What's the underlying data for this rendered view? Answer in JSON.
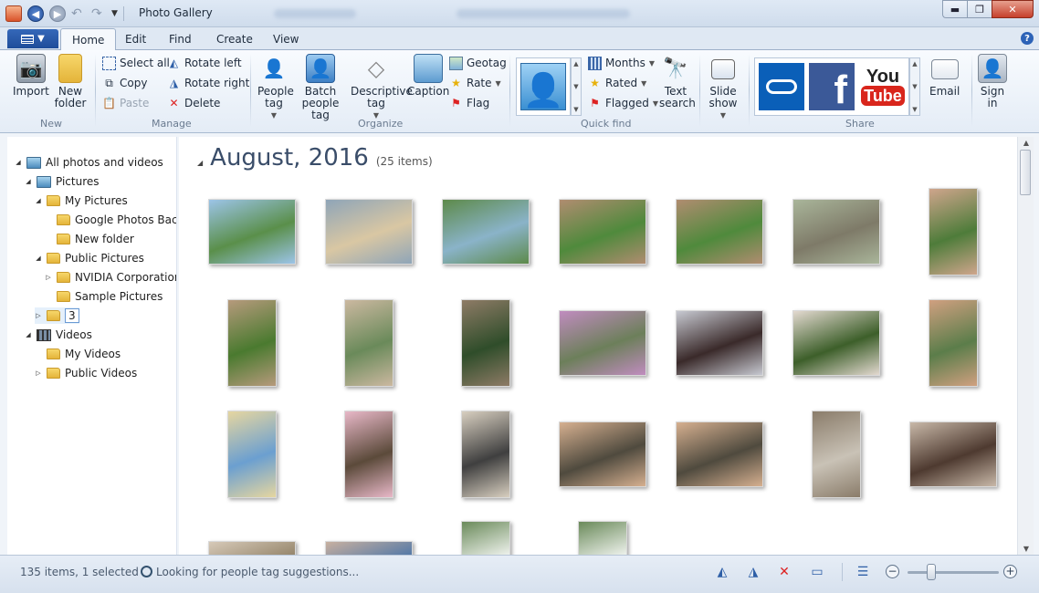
{
  "window": {
    "title": "Photo Gallery",
    "controls": {
      "minimize": "▬",
      "maximize": "❐",
      "close": "✕"
    }
  },
  "tabs": {
    "file": "",
    "items": [
      "Home",
      "Edit",
      "Find",
      "Create",
      "View"
    ],
    "active": "Home",
    "help": "?"
  },
  "ribbon": {
    "new": {
      "label": "New",
      "import": "Import",
      "new_folder": "New folder"
    },
    "manage": {
      "label": "Manage",
      "select_all": "Select all",
      "copy": "Copy",
      "paste": "Paste",
      "rotate_left": "Rotate left",
      "rotate_right": "Rotate right",
      "delete": "Delete"
    },
    "organize": {
      "label": "Organize",
      "people_tag": "People tag",
      "batch_people_tag": "Batch people tag",
      "descriptive_tag": "Descriptive tag",
      "caption": "Caption",
      "geotag": "Geotag",
      "rate": "Rate",
      "flag": "Flag"
    },
    "quick_find": {
      "label": "Quick find",
      "months": "Months",
      "rated": "Rated",
      "flagged": "Flagged",
      "text_search": "Text search"
    },
    "slide_show": "Slide show",
    "share": {
      "label": "Share",
      "youtube_word": "You",
      "youtube_tube": "Tube",
      "facebook": "f",
      "email": "Email",
      "sign_in": "Sign in"
    }
  },
  "nav_tree": [
    {
      "label": "All photos and videos",
      "indent": 0,
      "icon": "library-icon",
      "tri": "◢"
    },
    {
      "label": "Pictures",
      "indent": 1,
      "icon": "library-icon",
      "tri": "◢"
    },
    {
      "label": "My Pictures",
      "indent": 2,
      "icon": "folder-icon",
      "tri": "◢"
    },
    {
      "label": "Google Photos Backu",
      "indent": 3,
      "icon": "folder-icon",
      "tri": ""
    },
    {
      "label": "New folder",
      "indent": 3,
      "icon": "folder-icon",
      "tri": ""
    },
    {
      "label": "Public Pictures",
      "indent": 2,
      "icon": "folder-icon",
      "tri": "◢"
    },
    {
      "label": "NVIDIA Corporation",
      "indent": 3,
      "icon": "folder-icon",
      "tri": "▷"
    },
    {
      "label": "Sample Pictures",
      "indent": 3,
      "icon": "folder-icon",
      "tri": ""
    },
    {
      "label": "3",
      "indent": 2,
      "icon": "folder-icon",
      "tri": "▷",
      "selected": true
    },
    {
      "label": "Videos",
      "indent": 1,
      "icon": "film-icon",
      "tri": "◢"
    },
    {
      "label": "My Videos",
      "indent": 2,
      "icon": "folder-icon",
      "tri": ""
    },
    {
      "label": "Public Videos",
      "indent": 2,
      "icon": "folder-icon",
      "tri": "▷"
    }
  ],
  "content": {
    "month_title": "August, 2016",
    "count": "(25 items)",
    "thumbs": [
      {
        "c1": "#5a8f4a",
        "c2": "#9cc4e8"
      },
      {
        "c1": "#d9c7a3",
        "c2": "#8fa5b8"
      },
      {
        "c1": "#8ab3c9",
        "c2": "#5d8a4a"
      },
      {
        "c1": "#4f8a3c",
        "c2": "#b08c70"
      },
      {
        "c1": "#4f8a3c",
        "c2": "#b08c70"
      },
      {
        "c1": "#7e7a68",
        "c2": "#a9b59a"
      },
      {
        "c1": "#4e7c3a",
        "c2": "#cfa58c"
      },
      {
        "c1": "#4a7a2f",
        "c2": "#b69a7c"
      },
      {
        "c1": "#6a8a5a",
        "c2": "#cbb8a0"
      },
      {
        "c1": "#2f4d2a",
        "c2": "#8e7b66"
      },
      {
        "c1": "#6c7f5a",
        "c2": "#c08cbf"
      },
      {
        "c1": "#3a2a2a",
        "c2": "#c7c9d1"
      },
      {
        "c1": "#3d5f2a",
        "c2": "#e3d9d0"
      },
      {
        "c1": "#5b7d4a",
        "c2": "#d0a080"
      },
      {
        "c1": "#6b9fd0",
        "c2": "#e6d6a0"
      },
      {
        "c1": "#5b4a3a",
        "c2": "#e8b8c8"
      },
      {
        "c1": "#3f3f3f",
        "c2": "#d8cfc0"
      },
      {
        "c1": "#4f4a3e",
        "c2": "#d6b090"
      },
      {
        "c1": "#4f4a3e",
        "c2": "#d6b090"
      },
      {
        "c1": "#c9c2b6",
        "c2": "#8a7c6a"
      },
      {
        "c1": "#4e3a30",
        "c2": "#c8b8a8"
      },
      {
        "c1": "#8a7a5e",
        "c2": "#d6c9b8"
      },
      {
        "c1": "#3f6fa8",
        "c2": "#c8b0a0"
      },
      {
        "c1": "#ffffff",
        "c2": "#6a8a5a"
      },
      {
        "c1": "#ffffff",
        "c2": "#6a8a5a"
      }
    ]
  },
  "status": {
    "items": "135 items, 1 selected",
    "message": "Looking for people tag suggestions..."
  }
}
